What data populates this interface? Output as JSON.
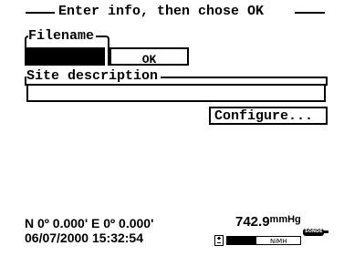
{
  "dialog": {
    "title": "Enter info, then chose OK"
  },
  "filename": {
    "label": "Filename",
    "value": ""
  },
  "ok_button": {
    "label": "OK"
  },
  "site_description": {
    "label": "Site description",
    "value": ""
  },
  "configure_button": {
    "label": "Configure..."
  },
  "status": {
    "coordinates": "N 0º 0.000' E 0º 0.000'",
    "datetime": "06/07/2000 15:32:54",
    "pressure_value": "742.9",
    "pressure_unit": "mmHg",
    "battery_type": "NiMH",
    "battery_level_fraction": 0.4,
    "sonde_label": "SONDE"
  },
  "colors": {
    "background": "#ffffff",
    "foreground": "#000000"
  },
  "icons": {
    "battery": "battery-icon",
    "sonde": "sonde-icon"
  }
}
